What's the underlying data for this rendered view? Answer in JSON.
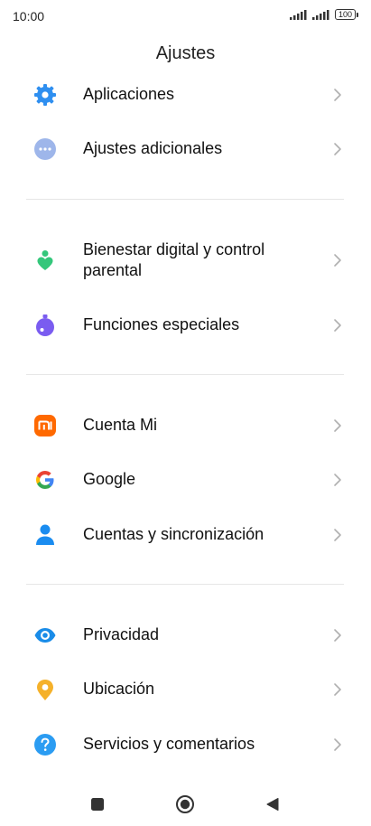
{
  "status_bar": {
    "time": "10:00",
    "signal_icon": "signal-bars-icon",
    "battery_level": "100"
  },
  "header": {
    "title": "Ajustes"
  },
  "settings_items": [
    {
      "label": "Aplicaciones",
      "icon": "gear-icon",
      "icon_color": "#2f8ff0"
    },
    {
      "label": "Ajustes adicionales",
      "icon": "more-dots-icon",
      "icon_color": "#9eb6ea"
    },
    {
      "label": "Bienestar digital y control parental",
      "icon": "wellbeing-heart-icon",
      "icon_color": "#34c77b"
    },
    {
      "label": "Funciones especiales",
      "icon": "special-features-icon",
      "icon_color": "#7a5cf0"
    },
    {
      "label": "Cuenta Mi",
      "icon": "mi-logo-icon",
      "icon_color": "#ff6900"
    },
    {
      "label": "Google",
      "icon": "google-g-icon",
      "icon_color": "#4285f4"
    },
    {
      "label": "Cuentas y sincronización",
      "icon": "person-icon",
      "icon_color": "#1a8cf0"
    },
    {
      "label": "Privacidad",
      "icon": "eye-icon",
      "icon_color": "#1a8ce8"
    },
    {
      "label": "Ubicación",
      "icon": "location-pin-icon",
      "icon_color": "#f5b12a"
    },
    {
      "label": "Servicios y comentarios",
      "icon": "help-question-icon",
      "icon_color": "#2b9cf2"
    }
  ],
  "nav_bar": {
    "recents_icon": "square-recents-icon",
    "home_icon": "circle-home-icon",
    "back_icon": "triangle-back-icon"
  }
}
